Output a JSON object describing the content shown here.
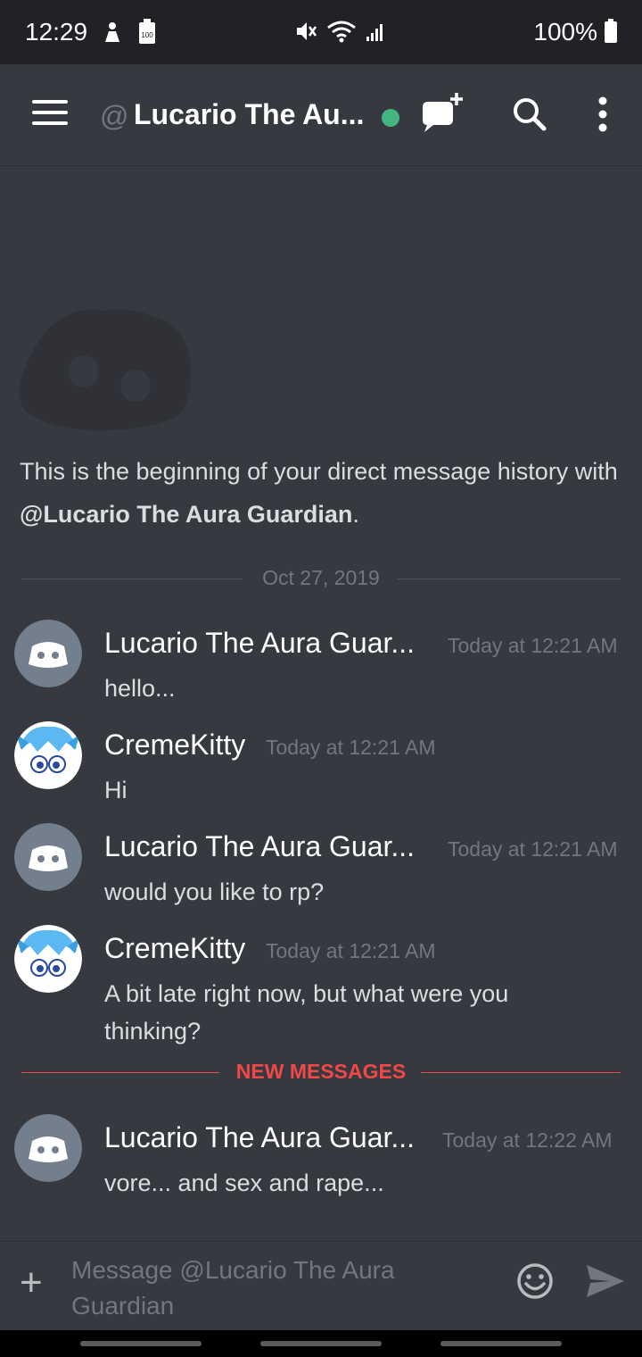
{
  "status_bar": {
    "time": "12:29",
    "battery": "100%",
    "badge": "100"
  },
  "header": {
    "at": "@",
    "title": "Lucario The Au...",
    "status": "online"
  },
  "intro": {
    "text_before": "This is the beginning of your direct message history with ",
    "mention": "@Lucario The Aura Guardian",
    "text_after": "."
  },
  "date_divider": "Oct 27, 2019",
  "new_messages_label": "NEW MESSAGES",
  "messages": [
    {
      "author": "Lucario The Aura Guar...",
      "timestamp": "Today at 12:21 AM",
      "content": "hello..."
    },
    {
      "author": "CremeKitty",
      "timestamp": "Today at 12:21 AM",
      "content": "Hi"
    },
    {
      "author": "Lucario The Aura Guar...",
      "timestamp": "Today at 12:21 AM",
      "content": "would you like to rp?"
    },
    {
      "author": "CremeKitty",
      "timestamp": "Today at 12:21 AM",
      "content": "A bit late right now, but what were you thinking?"
    },
    {
      "author": "Lucario The Aura Guar...",
      "timestamp": "Today at 12:22 AM",
      "content": "vore... and sex and rape..."
    }
  ],
  "composer": {
    "placeholder": "Message @Lucario The Aura Guardian"
  },
  "colors": {
    "background": "#36393f",
    "online": "#43b581",
    "new_messages": "#f04747",
    "muted": "#72767d"
  },
  "icons": [
    "menu-icon",
    "new-dm-icon",
    "search-icon",
    "more-icon",
    "plus-icon",
    "emoji-icon",
    "send-icon"
  ]
}
